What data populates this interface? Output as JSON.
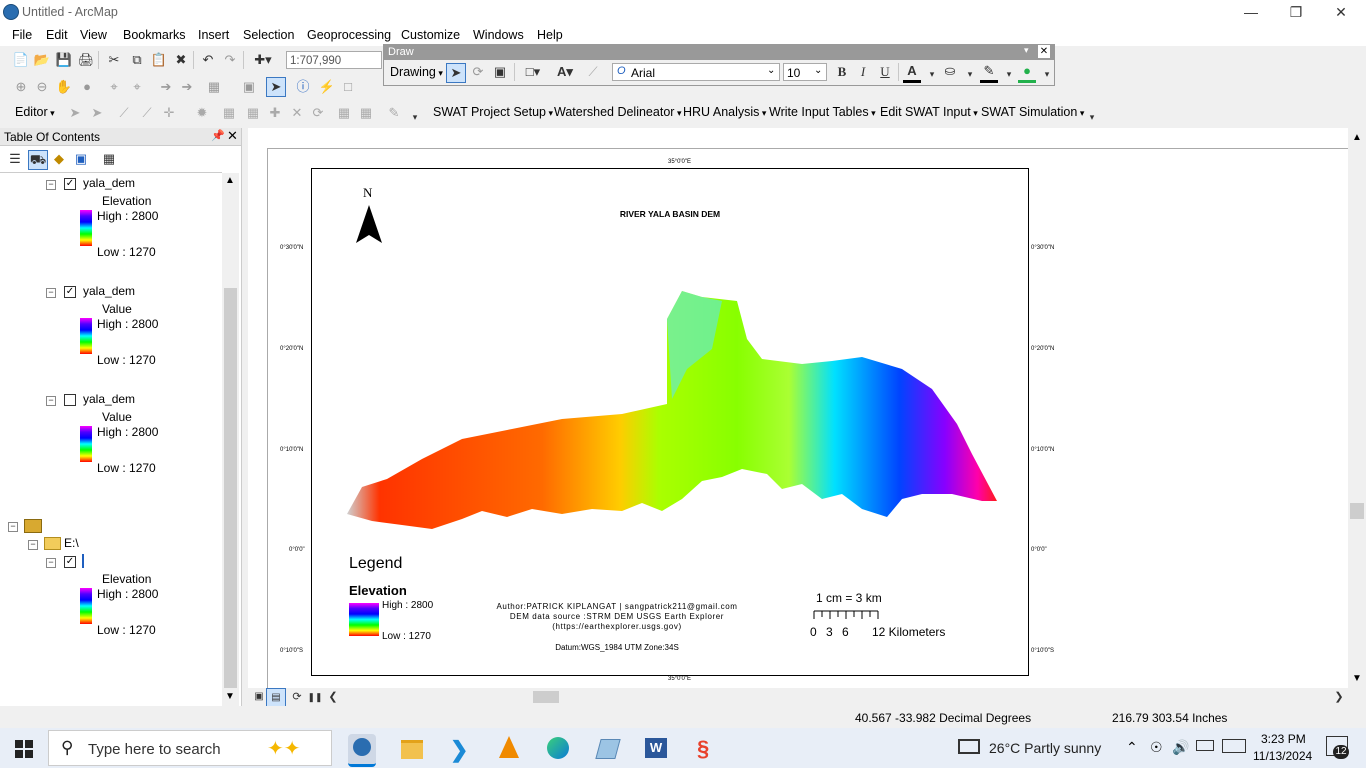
{
  "window": {
    "title": "Untitled - ArcMap"
  },
  "menu": [
    "File",
    "Edit",
    "View",
    "Bookmarks",
    "Insert",
    "Selection",
    "Geoprocessing",
    "Customize",
    "Windows",
    "Help"
  ],
  "standard_toolbar": {
    "scale": "1:707,990"
  },
  "draw_toolbar": {
    "title": "Draw",
    "drawing_label": "Drawing",
    "font": "Arial",
    "size": "10",
    "bold": "B",
    "italic": "I",
    "underline": "U",
    "font_color_glyph": "A"
  },
  "editor_toolbar": {
    "editor_label": "Editor"
  },
  "swat_toolbar": [
    "SWAT Project Setup",
    "Watershed Delineator",
    "HRU Analysis",
    "Write Input Tables",
    "Edit SWAT Input",
    "SWAT Simulation"
  ],
  "toc": {
    "title": "Table Of Contents",
    "layers": [
      {
        "name": "yala_dem",
        "checked": true,
        "field": "Elevation",
        "high": "High : 2800",
        "low": "Low : 1270"
      },
      {
        "name": "yala_dem",
        "checked": true,
        "field": "Value",
        "high": "High : 2800",
        "low": "Low : 1270"
      },
      {
        "name": "yala_dem",
        "checked": false,
        "field": "Value",
        "high": "High : 2800",
        "low": "Low : 1270"
      }
    ],
    "folder": "E:\\",
    "folder_layer": {
      "field": "Elevation",
      "high": "High : 2800",
      "low": "Low : 1270"
    }
  },
  "map": {
    "title": "RIVER YALA BASIN DEM",
    "north": "N",
    "legend_title": "Legend",
    "legend_field": "Elevation",
    "legend_high": "High : 2800",
    "legend_low": "Low : 1270",
    "author": "Author:PATRICK KIPLANGAT | sangpatrick211@gmail.com",
    "source": "DEM data source :STRM DEM USGS Earth Explorer",
    "url": "(https://earthexplorer.usgs.gov)",
    "datum": "Datum:WGS_1984 UTM Zone:34S",
    "scale_text": "1 cm = 3 km",
    "scale_ticks": [
      "0",
      "3",
      "6",
      "12 Kilometers"
    ],
    "grat_top": "35°0'0\"E",
    "grat_bottom": "35°0'0\"E",
    "grat_lat": [
      "0°30'0\"N",
      "0°20'0\"N",
      "0°10'0\"N",
      "0°0'0\"",
      "0°10'0\"S"
    ]
  },
  "status": {
    "coords": "40.567  -33.982 Decimal Degrees",
    "page": "216.79  303.54 Inches"
  },
  "taskbar": {
    "search": "Type here to search",
    "weather": "26°C  Partly sunny",
    "time": "3:23 PM",
    "date": "11/13/2024",
    "badge": "12"
  },
  "colors": {
    "ramp_high": "#ff00ff",
    "ramp_low": "#ff0000",
    "accent": "#0078d7"
  }
}
